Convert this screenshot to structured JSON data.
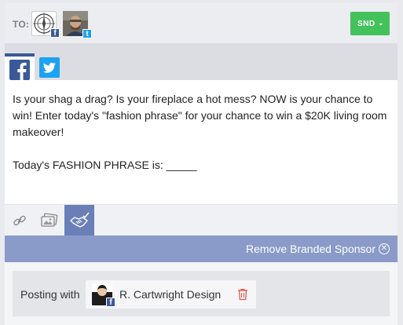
{
  "header": {
    "to_label": "TO:",
    "recipients": [
      {
        "name": "circle-logo-avatar",
        "network": "facebook",
        "badge": "f"
      },
      {
        "name": "person-avatar",
        "network": "twitter",
        "badge": "t"
      }
    ],
    "send_label": "SND"
  },
  "network_tabs": [
    {
      "network": "facebook",
      "active": true
    },
    {
      "network": "twitter",
      "active": false
    }
  ],
  "editor": {
    "paragraphs": [
      "Is your shag a drag? Is your fireplace a hot mess? NOW is your chance to win! Enter today's \"fashion phrase\" for your chance to win a $20K living room makeover!",
      "Today's FASHION PHRASE is: _____"
    ]
  },
  "toolbar": {
    "tools": [
      "link-icon",
      "photo-icon",
      "handshake-icon"
    ],
    "active_tool": "handshake-icon"
  },
  "sponsor": {
    "remove_label": "Remove Branded Sponsor",
    "posting_label": "Posting with",
    "account_name": "R. Cartwright Design",
    "account_network": "facebook"
  },
  "colors": {
    "send_green": "#43c15a",
    "facebook_blue": "#3b5998",
    "twitter_blue": "#1da1f2",
    "sponsor_bar": "#8a9bc9",
    "active_tool": "#6a7fb8",
    "trash_red": "#e05a4e"
  }
}
